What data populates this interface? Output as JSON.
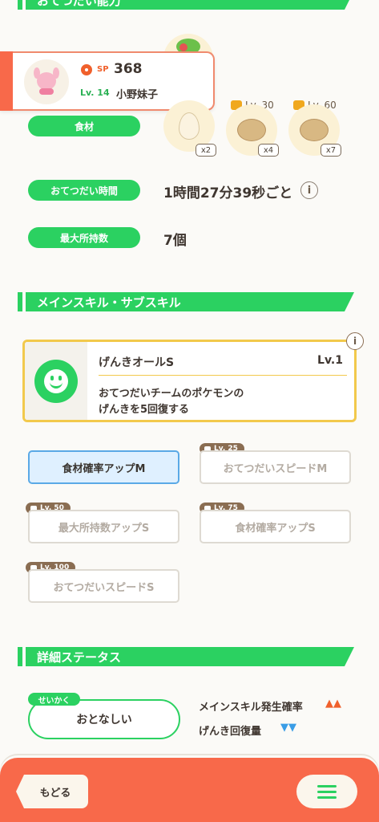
{
  "top_section": {
    "title": "おてつだい能力"
  },
  "popup": {
    "level": "Lv. 14",
    "sp_label": "SP",
    "sp_value": "368",
    "name": "小野妹子"
  },
  "ingredients": {
    "label": "食材",
    "items": [
      {
        "multiplier": "x2",
        "unlock": ""
      },
      {
        "multiplier": "x4",
        "unlock": "Lv. 30"
      },
      {
        "multiplier": "x7",
        "unlock": "Lv. 60"
      }
    ]
  },
  "help_time": {
    "label": "おてつだい時間",
    "value": "1時間27分39秒ごと"
  },
  "max_carry": {
    "label": "最大所持数",
    "value": "7個"
  },
  "skill_section": {
    "title": "メインスキル・サブスキル"
  },
  "main_skill": {
    "name": "げんきオールS",
    "level": "Lv.1",
    "desc_line1": "おてつだいチームのポケモンの",
    "desc_line2": "げんきを5回復する"
  },
  "subskills": [
    {
      "label": "食材確率アップM",
      "level": "",
      "active": true
    },
    {
      "label": "おてつだいスピードM",
      "level": "Lv. 25",
      "active": false
    },
    {
      "label": "最大所持数アップS",
      "level": "Lv. 50",
      "active": false
    },
    {
      "label": "食材確率アップS",
      "level": "Lv. 75",
      "active": false
    },
    {
      "label": "おてつだいスピードS",
      "level": "Lv. 100",
      "active": false
    }
  ],
  "detail_section": {
    "title": "詳細ステータス"
  },
  "nature": {
    "tag": "せいかく",
    "value": "おとなしい",
    "up_label": "メインスキル発生確率",
    "up_marks": "▲▲",
    "down_label": "げんき回復量",
    "down_marks": "▼▼"
  },
  "footer": {
    "back_label": "もどる"
  },
  "colors": {
    "accent_green": "#2bd161",
    "footer_orange": "#f8694a",
    "up": "#f0602c",
    "down": "#3a9de6"
  }
}
